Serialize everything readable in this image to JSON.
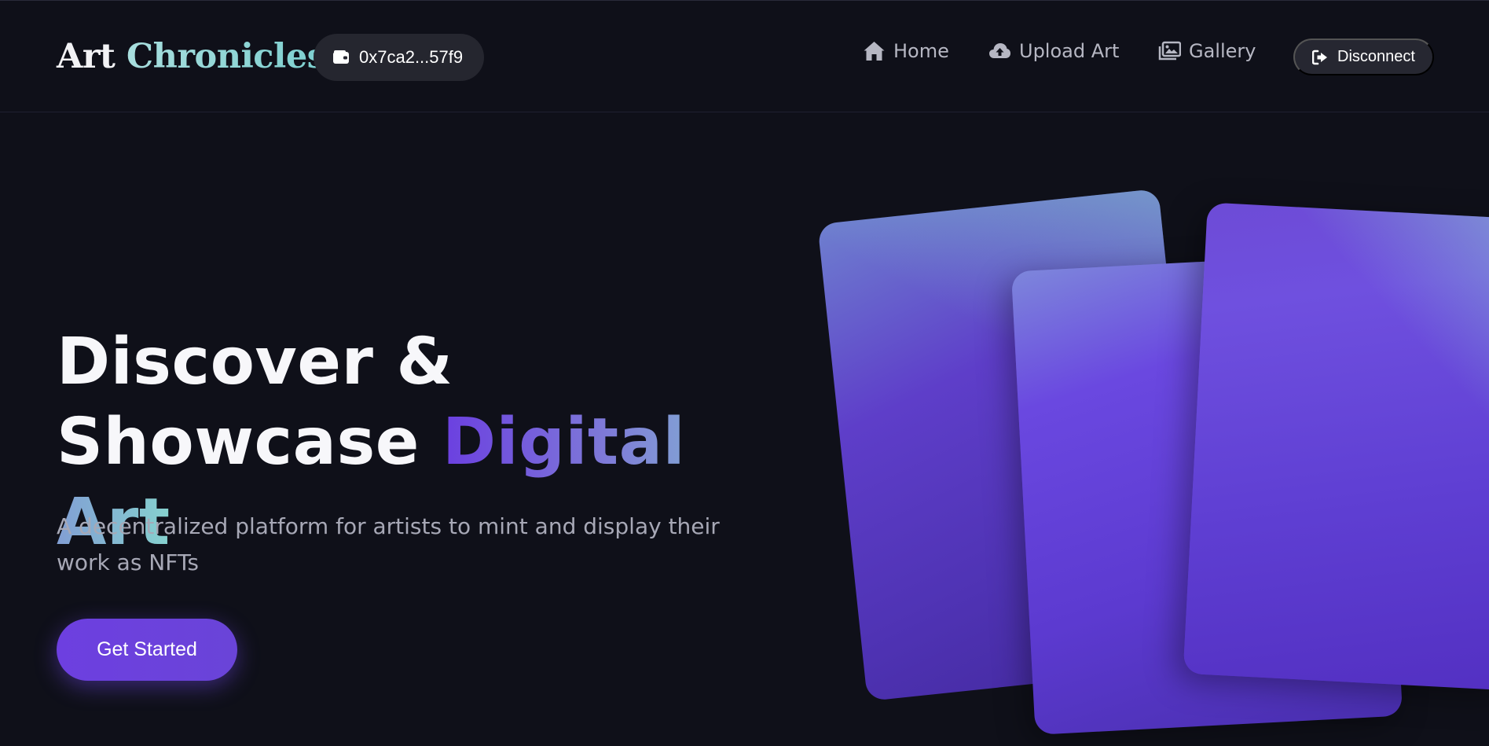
{
  "brand": {
    "word1": "Art",
    "word2": "Chronicles"
  },
  "wallet": {
    "address": "0x7ca2...57f9",
    "icon": "wallet-icon"
  },
  "nav": {
    "items": [
      {
        "label": "Home",
        "icon": "home-icon"
      },
      {
        "label": "Upload Art",
        "icon": "cloud-upload-icon"
      },
      {
        "label": "Gallery",
        "icon": "images-icon"
      }
    ],
    "disconnect": {
      "label": "Disconnect",
      "icon": "sign-out-icon"
    }
  },
  "hero": {
    "title_line1": "Discover &",
    "title_line2": "Showcase",
    "title_highlight": "Digital Art",
    "subtitle": "A decentralized platform for artists to mint and display their work as NFTs",
    "cta_label": "Get Started"
  },
  "colors": {
    "background": "#0f1019",
    "accent_purple": "#6b3fe0",
    "accent_teal": "#86d2cf",
    "pill_bg": "#25262f"
  }
}
